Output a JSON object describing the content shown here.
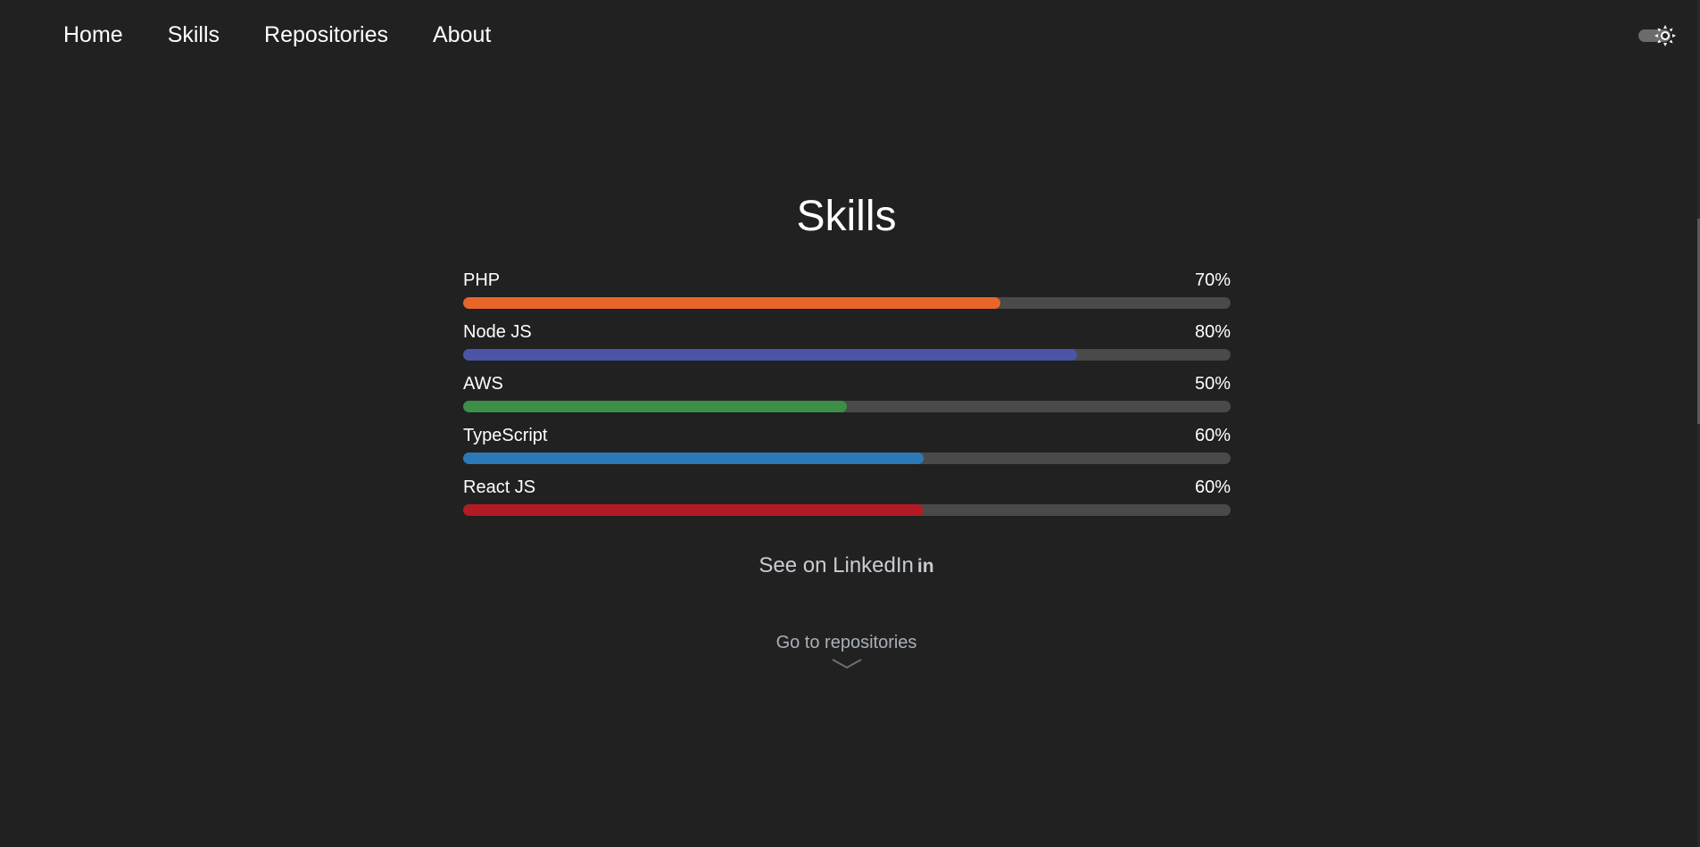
{
  "nav": {
    "items": [
      {
        "label": "Home"
      },
      {
        "label": "Skills"
      },
      {
        "label": "Repositories"
      },
      {
        "label": "About"
      }
    ],
    "theme_toggle_icon": "sun-icon"
  },
  "skills": {
    "title": "Skills",
    "items": [
      {
        "name": "PHP",
        "percent_label": "70%",
        "value": 70,
        "color": "#e8662a"
      },
      {
        "name": "Node JS",
        "percent_label": "80%",
        "value": 80,
        "color": "#4a55a8"
      },
      {
        "name": "AWS",
        "percent_label": "50%",
        "value": 50,
        "color": "#3b8f47"
      },
      {
        "name": "TypeScript",
        "percent_label": "60%",
        "value": 60,
        "color": "#2a7ab8"
      },
      {
        "name": "React JS",
        "percent_label": "60%",
        "value": 60,
        "color": "#b31b24"
      }
    ]
  },
  "links": {
    "linkedin_label": "See on LinkedIn",
    "linkedin_icon": "linkedin-icon",
    "linkedin_icon_text": "in",
    "goto_repos_label": "Go to repositories",
    "goto_icon": "chevron-down-icon"
  }
}
